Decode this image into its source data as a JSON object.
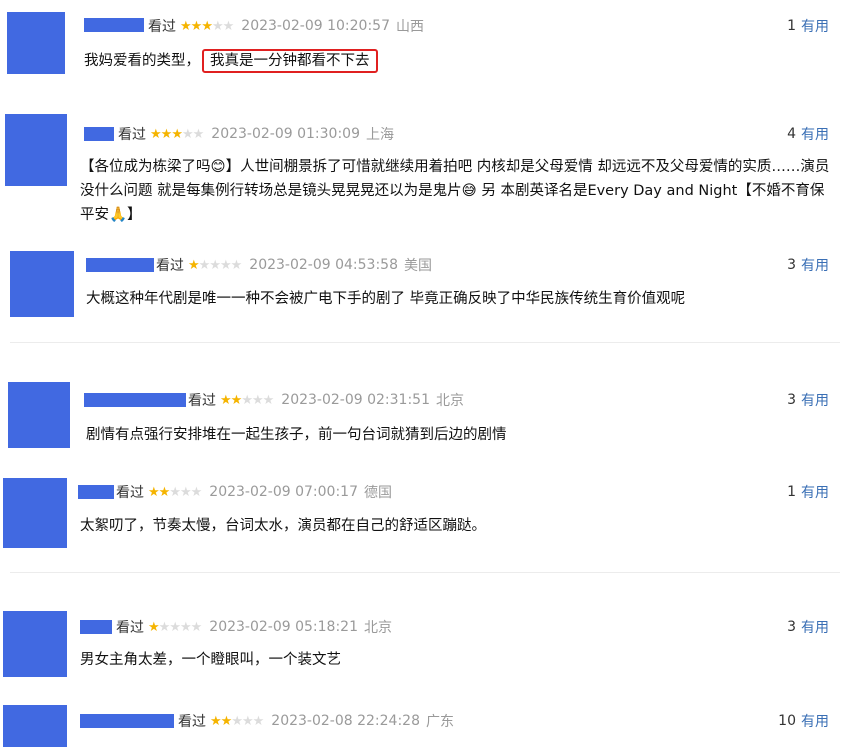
{
  "common": {
    "status": "看过",
    "useful_label": "有用"
  },
  "comments": [
    {
      "rating": 3,
      "time": "2023-02-09 10:20:57",
      "location": "山西",
      "useful": "1",
      "text_plain": "我妈爱看的类型，",
      "text_highlight": "我真是一分钟都看不下去"
    },
    {
      "rating": 3,
      "time": "2023-02-09 01:30:09",
      "location": "上海",
      "useful": "4",
      "text": "【各位成为栋梁了吗😊】人世间棚景拆了可惜就继续用着拍吧 内核却是父母爱情 却远远不及父母爱情的实质……演员没什么问题 就是每集例行转场总是镜头晃晃晃还以为是鬼片😅 另 本剧英译名是Every Day and Night【不婚不育保平安🙏】"
    },
    {
      "rating": 1,
      "time": "2023-02-09 04:53:58",
      "location": "美国",
      "useful": "3",
      "text": "大概这种年代剧是唯一一种不会被广电下手的剧了 毕竟正确反映了中华民族传统生育价值观呢"
    },
    {
      "rating": 2,
      "time": "2023-02-09 02:31:51",
      "location": "北京",
      "useful": "3",
      "text": "剧情有点强行安排堆在一起生孩子，前一句台词就猜到后边的剧情"
    },
    {
      "rating": 2,
      "time": "2023-02-09 07:00:17",
      "location": "德国",
      "useful": "1",
      "text": "太絮叨了，节奏太慢，台词太水，演员都在自己的舒适区蹦跶。"
    },
    {
      "rating": 1,
      "time": "2023-02-09 05:18:21",
      "location": "北京",
      "useful": "3",
      "text": "男女主角太差，一个瞪眼叫，一个装文艺"
    },
    {
      "rating": 2,
      "time": "2023-02-08 22:24:28",
      "location": "广东",
      "useful": "10",
      "text": ""
    }
  ]
}
